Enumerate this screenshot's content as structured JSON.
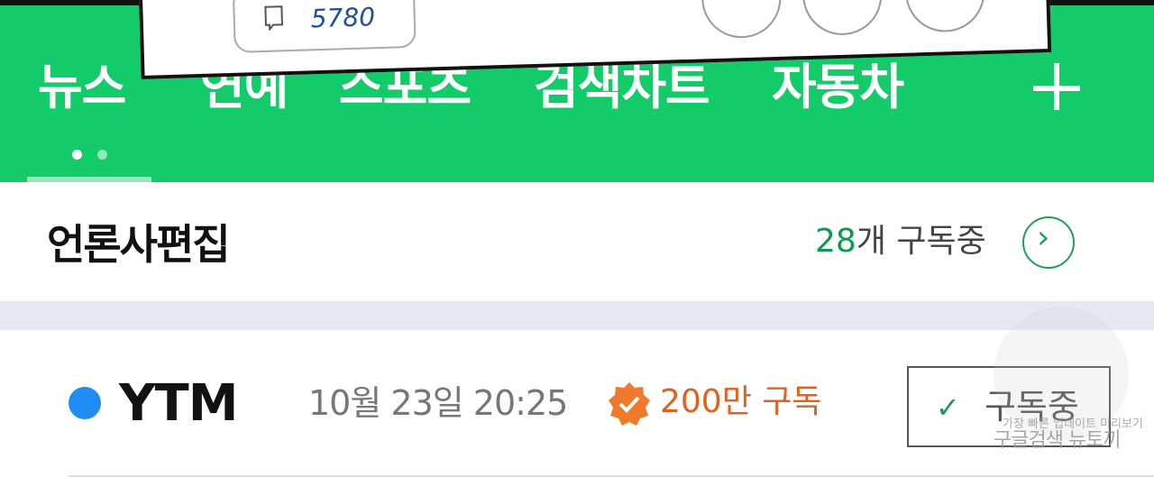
{
  "overlay": {
    "comment_count": "5780"
  },
  "nav": {
    "tabs": [
      "뉴스",
      "연예",
      "스포츠",
      "검색차트",
      "자동차"
    ],
    "add_icon": "plus-icon",
    "background": "#13cc69"
  },
  "section": {
    "title": "언론사편집",
    "subscribe_count": "28",
    "subscribe_suffix": "개 구독중"
  },
  "publisher": {
    "name": "YTM",
    "time": "10월 23일 20:25",
    "subscribers": "200만 구독",
    "subscribe_button": "구독중",
    "dot_color": "#1e8cf0",
    "badge_color": "#f07a2c"
  },
  "watermark": {
    "line1": "가장 빠른 업데이트 미리보기",
    "line2": "구글검색 뉴토끼"
  }
}
